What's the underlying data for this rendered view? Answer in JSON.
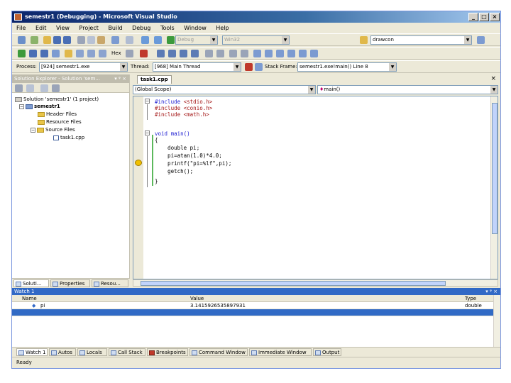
{
  "window": {
    "title": "semestr1 (Debugging) - Microsoft Visual Studio"
  },
  "caption_buttons": {
    "minimize": "_",
    "maximize": "□",
    "close": "×"
  },
  "menu": [
    "File",
    "Edit",
    "View",
    "Project",
    "Build",
    "Debug",
    "Tools",
    "Window",
    "Help"
  ],
  "toolbar1": {
    "config": "Debug",
    "platform": "Win32",
    "find_combo": "drawcon"
  },
  "toolbar2": {
    "hex_label": "Hex"
  },
  "toolbar3": {
    "process_label": "Process:",
    "process_value": "[924] semestr1.exe",
    "thread_label": "Thread:",
    "thread_value": "[968] Main Thread",
    "stackframe_label": "Stack Frame:",
    "stackframe_value": "semestr1.exe!main() Line 8"
  },
  "solution_explorer": {
    "title": "Solution Explorer - Solution 'sem...",
    "title_controls": "▾ ᵠ ×",
    "tree": {
      "solution": "Solution 'semestr1' (1 project)",
      "project": "semestr1",
      "header_files": "Header Files",
      "resource_files": "Resource Files",
      "source_files": "Source Files",
      "file": "task1.cpp"
    },
    "tabs": [
      "Soluti...",
      "Properties",
      "Resou..."
    ]
  },
  "editor": {
    "tab": "task1.cpp",
    "close": "×",
    "scope_combo": "(Global Scope)",
    "member_combo": "main()",
    "code": [
      "#include <stdio.h>",
      "#include <conio.h>",
      "#include <math.h>",
      "",
      "void main()",
      "{",
      "    double pi;",
      "    pi=atan(1.0)*4.0;",
      "    printf(\"pi=%lf\",pi);",
      "    getch();",
      "}"
    ]
  },
  "watch": {
    "title": "Watch 1",
    "title_controls": "▾ ᵠ ×",
    "columns": [
      "Name",
      "Value",
      "Type"
    ],
    "rows": [
      {
        "name": "pi",
        "value": "3.1415926535897931",
        "type": "double"
      }
    ],
    "tabs": [
      "Watch 1",
      "Autos",
      "Locals",
      "Call Stack",
      "Breakpoints",
      "Command Window",
      "Immediate Window",
      "Output"
    ]
  },
  "status": {
    "text": "Ready"
  },
  "colors": {
    "title_start": "#0a246a",
    "title_end": "#a6caf0",
    "selection": "#316ac5",
    "keyword": "#1a1ad1",
    "string": "#a31515"
  }
}
